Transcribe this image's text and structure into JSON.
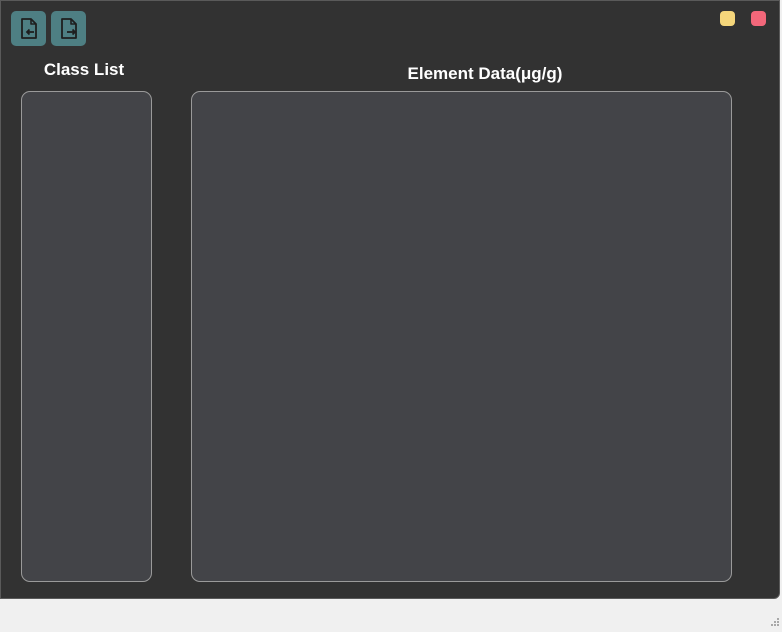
{
  "toolbar": {
    "buttons": [
      {
        "name": "import",
        "icon": "file-import-icon"
      },
      {
        "name": "export",
        "icon": "file-export-icon"
      }
    ],
    "button_color": "#4e7f83"
  },
  "window_controls": {
    "minimize_color": "#f5d67b",
    "close_color": "#f2677a"
  },
  "panels": {
    "class_list": {
      "title": "Class List",
      "items": []
    },
    "element_data": {
      "title": "Element Data(μg/g)",
      "rows": []
    }
  },
  "colors": {
    "window_bg": "#323232",
    "panel_bg": "#434448",
    "panel_border": "#9a9a9a",
    "title_text": "#ffffff"
  }
}
